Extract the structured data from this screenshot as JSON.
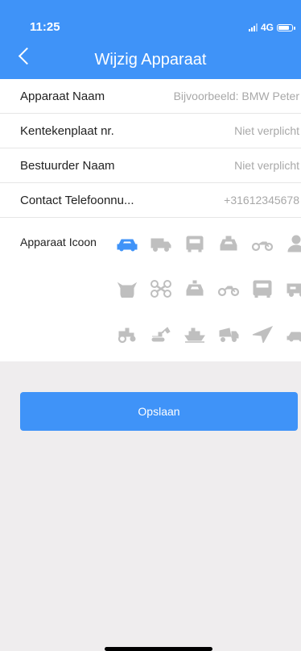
{
  "status": {
    "time": "11:25",
    "network": "4G"
  },
  "header": {
    "title": "Wijzig Apparaat"
  },
  "form": {
    "rows": [
      {
        "label": "Apparaat Naam",
        "value": "Bijvoorbeeld: BMW Peter"
      },
      {
        "label": "Kentekenplaat nr.",
        "value": "Niet verplicht"
      },
      {
        "label": "Bestuurder Naam",
        "value": "Niet verplicht"
      },
      {
        "label": "Contact Telefoonnu...",
        "value": "+31612345678"
      }
    ],
    "icon_label": "Apparaat Icoon",
    "icons": [
      "car-icon",
      "truck-icon",
      "bus-icon",
      "taxi-icon",
      "motorcycle-icon",
      "person-icon",
      "cow-icon",
      "drone-icon",
      "police-car-icon",
      "motorbike-icon",
      "coach-icon",
      "tuk-tuk-icon",
      "tractor-icon",
      "excavator-icon",
      "ship-icon",
      "cement-mixer-icon",
      "navigation-arrow-icon",
      "small-car-icon"
    ],
    "selected_icon": "car-icon",
    "selected_color": "#3f93f8",
    "icon_color": "#bfbfbf"
  },
  "actions": {
    "save_label": "Opslaan"
  },
  "colors": {
    "accent": "#3f93f8",
    "background": "#efedee"
  }
}
